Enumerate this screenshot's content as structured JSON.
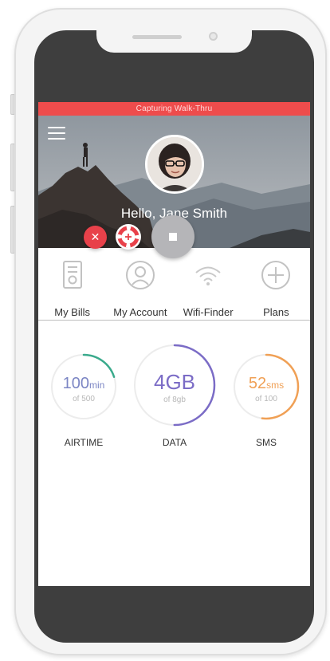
{
  "capture_banner": "Capturing Walk-Thru",
  "profile": {
    "greeting": "Hello, Jane Smith"
  },
  "quick_nav": [
    {
      "label": "My Bills",
      "icon": "bill-icon"
    },
    {
      "label": "My Account",
      "icon": "user-icon"
    },
    {
      "label": "Wifi-Finder",
      "icon": "wifi-icon"
    },
    {
      "label": "Plans",
      "icon": "plus-circle-icon"
    }
  ],
  "usage": {
    "airtime": {
      "value": "100",
      "unit": "min",
      "sub": "of 500",
      "label": "AIRTIME",
      "fraction": 0.2,
      "color": "#3aaa8c"
    },
    "data": {
      "value": "4GB",
      "sub": "of 8gb",
      "label": "DATA",
      "fraction": 0.5,
      "color": "#7b6cc6"
    },
    "sms": {
      "value": "52",
      "unit": "sms",
      "sub": "of 100",
      "label": "SMS",
      "fraction": 0.52,
      "color": "#f0a055"
    }
  },
  "colors": {
    "accent": "#ee4c4c",
    "recorder_close": "#e8414a"
  }
}
